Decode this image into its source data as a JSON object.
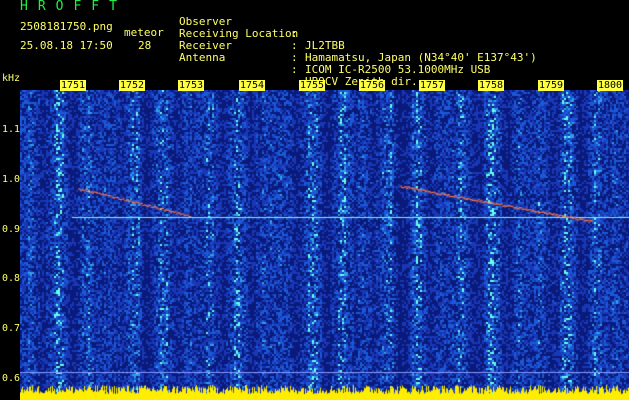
{
  "header": {
    "logo": "HROFFT",
    "filename": "2508181750.png",
    "meteor_label": "meteor",
    "datetime": "25.08.18 17:50",
    "meteor_count": "28"
  },
  "info": [
    {
      "key": "Observer",
      "value": "JL2TBB"
    },
    {
      "key": "Receiving Location",
      "value": "Hamamatsu, Japan (N34°40' E137°43')"
    },
    {
      "key": "Receiver",
      "value": "ICOM IC-R2500 53.1000MHz USB"
    },
    {
      "key": "Antenna",
      "value": "HB9CV Zenith dir."
    }
  ],
  "axis": {
    "y_unit": "kHz",
    "y_ticks": [
      "1.1",
      "1.0",
      "0.9",
      "0.8",
      "0.7",
      "0.6"
    ],
    "x_ticks": [
      "1751",
      "1752",
      "1753",
      "1754",
      "1755",
      "1756",
      "1757",
      "1758",
      "1759",
      "1800"
    ]
  },
  "colors": {
    "text": "#ffff66",
    "logo": "#22ee44",
    "bg_noise": "#1a3cc8",
    "carrier": "#66ffee",
    "trace": "#ff7744",
    "baseline": "#ffee00"
  }
}
